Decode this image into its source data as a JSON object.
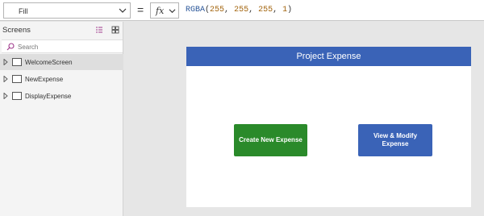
{
  "formula_bar": {
    "property": "Fill",
    "equals": "=",
    "fx_label": "fx",
    "formula": {
      "func": "RGBA",
      "open": "(",
      "args": [
        "255",
        "255",
        "255",
        "1"
      ],
      "close": ")"
    }
  },
  "screens_panel": {
    "title": "Screens",
    "search_placeholder": "Search",
    "items": [
      {
        "label": "WelcomeScreen",
        "selected": true
      },
      {
        "label": "NewExpense",
        "selected": false
      },
      {
        "label": "DisplayExpense",
        "selected": false
      }
    ]
  },
  "app_screen": {
    "header_title": "Project Expense",
    "header_color": "#3a63b7",
    "create_button": "Create New Expense",
    "create_color": "#2a8a2a",
    "modify_button_line1": "View & Modify",
    "modify_button_line2": "Expense",
    "modify_color": "#3a63b7"
  },
  "icons": [
    "chevron-down-icon",
    "fx-icon",
    "list-view-icon",
    "grid-view-icon",
    "search-icon",
    "caret-right-icon",
    "screen-icon"
  ]
}
